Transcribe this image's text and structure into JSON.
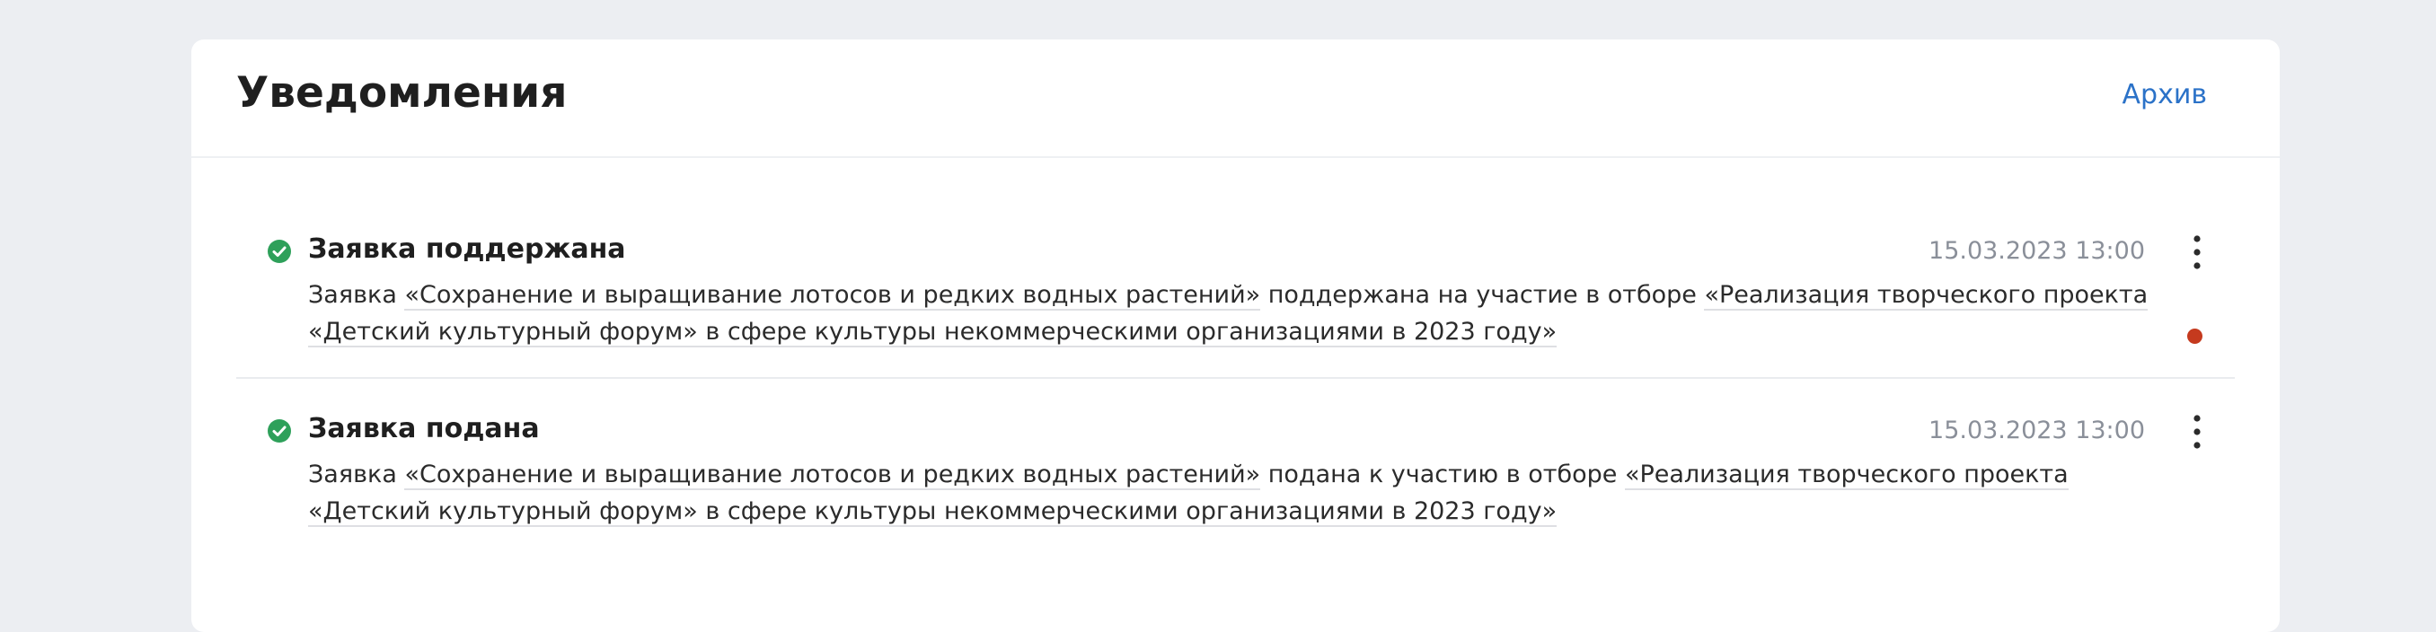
{
  "header": {
    "title": "Уведомления",
    "archive_label": "Архив"
  },
  "colors": {
    "accent": "#2b72c8",
    "success": "#2ea05a",
    "unread": "#c53a1e",
    "background": "#eceef2"
  },
  "icons": {
    "status": "check-circle-icon",
    "menu": "more-vertical-icon"
  },
  "notifications": [
    {
      "title": "Заявка поддержана",
      "time": "15.03.2023 13:00",
      "unread": true,
      "prefix": "Заявка ",
      "application_link": "«Сохранение и выращивание лотосов и редких водных растений»",
      "middle": " поддержана на участие в отборе ",
      "selection_link": "«Реализация творческого проекта «Детский культурный форум» в сфере культуры некоммерческими организациями в 2023 году»"
    },
    {
      "title": "Заявка подана",
      "time": "15.03.2023 13:00",
      "unread": false,
      "prefix": "Заявка ",
      "application_link": "«Сохранение и выращивание лотосов и редких водных растений»",
      "middle": " подана к участию в отборе ",
      "selection_link": "«Реализация творческого проекта «Детский культурный форум» в сфере культуры некоммерческими организациями в 2023 году»"
    }
  ]
}
